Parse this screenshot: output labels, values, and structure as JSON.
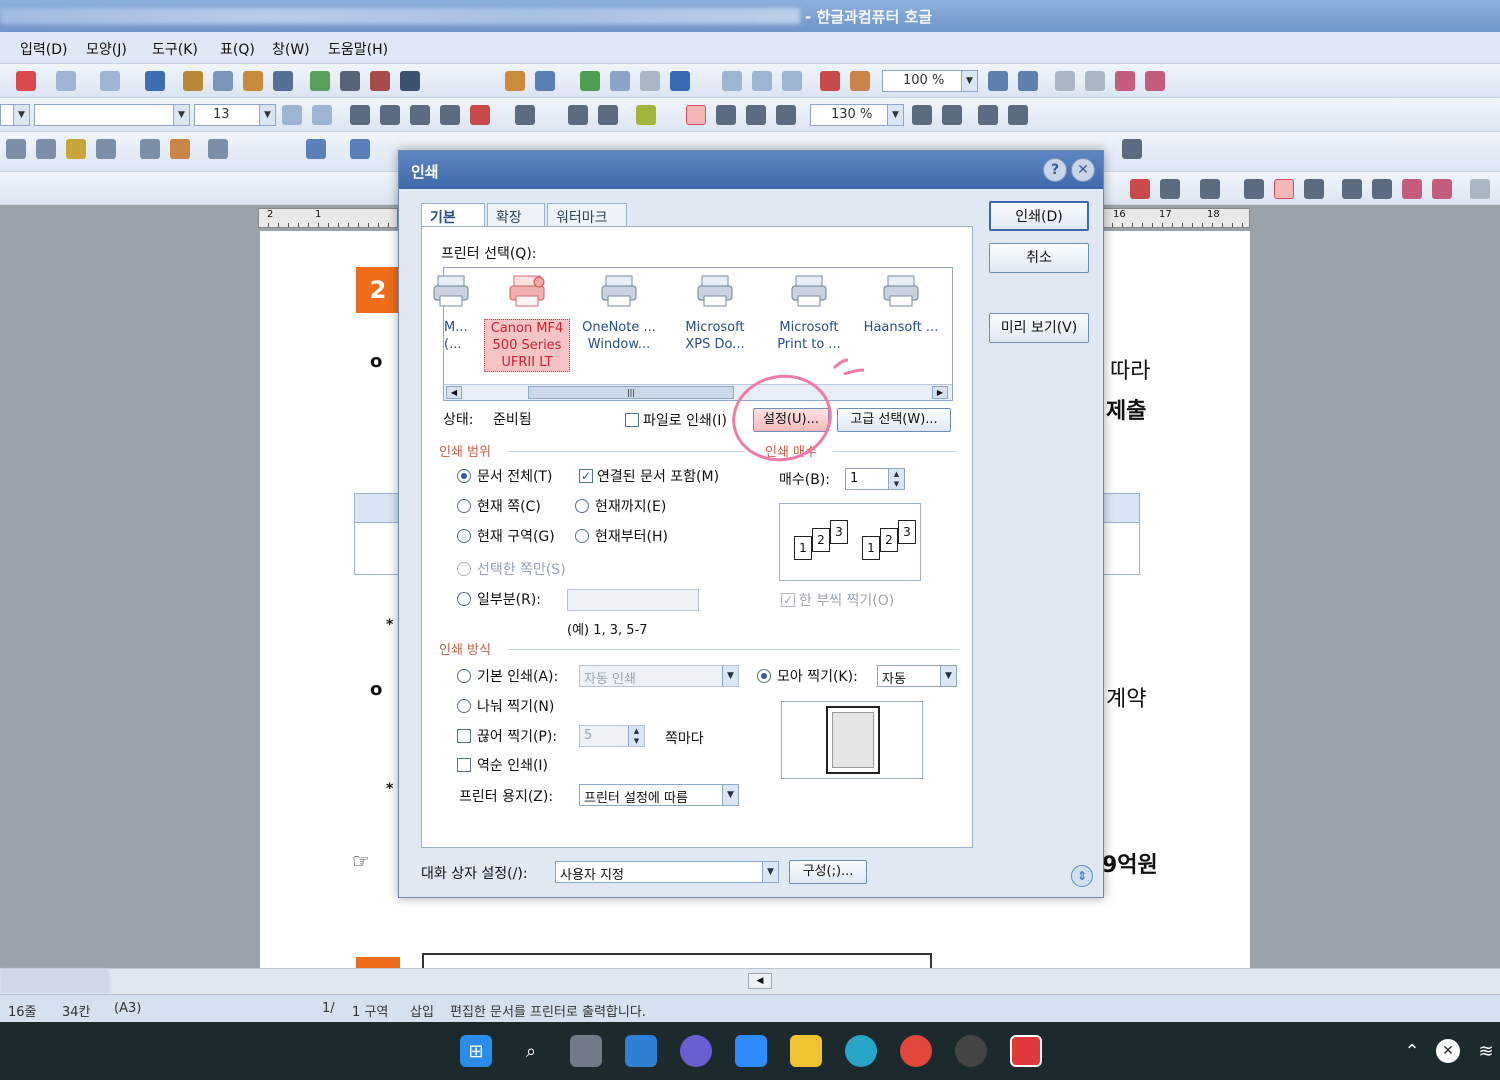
{
  "app": {
    "title": "- 한글과컴퓨터 호글"
  },
  "menu": [
    "입력(D)",
    "모양(J)",
    "도구(K)",
    "표(Q)",
    "창(W)",
    "도움말(H)"
  ],
  "toolbar": {
    "zoom": "100 %",
    "font_size": "13",
    "line_spacing": "130 %"
  },
  "ruler": {
    "left_ticks": [
      "2",
      "1"
    ],
    "right_ticks": [
      "16",
      "17",
      "18"
    ]
  },
  "document": {
    "badge_number": "2",
    "text_right_1": "따라",
    "text_right_2": "제출",
    "text_right_3": "계약",
    "text_right_4": "9억원",
    "bullet": "o",
    "star": "*"
  },
  "dialog": {
    "title": "인쇄",
    "tabs": [
      "기본",
      "확장",
      "워터마크"
    ],
    "printer_select_label": "프린터 선택(Q):",
    "printers": [
      {
        "name": "M...\n(...",
        "selected": false
      },
      {
        "name": "Canon MF4\n500 Series\nUFRII LT",
        "selected": true
      },
      {
        "name": "OneNote ...\nWindow...",
        "selected": false
      },
      {
        "name": "Microsoft\nXPS Do...",
        "selected": false
      },
      {
        "name": "Microsoft\nPrint to ...",
        "selected": false
      },
      {
        "name": "Haansoft ...",
        "selected": false
      }
    ],
    "status_label": "상태:",
    "status_value": "준비됨",
    "print_to_file": "파일로 인쇄(I)",
    "settings_button": "설정(U)...",
    "advanced_button": "고급 선택(W)...",
    "buttons": {
      "print": "인쇄(D)",
      "cancel": "취소",
      "preview": "미리 보기(V)"
    },
    "range_section": "인쇄 범위",
    "range_options": {
      "all": "문서 전체(T)",
      "linked": "연결된 문서 포함(M)",
      "current_page": "현재 쪽(C)",
      "until_current": "현재까지(E)",
      "current_section": "현재 구역(G)",
      "from_current": "현재부터(H)",
      "selected_pages": "선택한 쪽만(S)",
      "partial": "일부분(R):",
      "partial_value": "",
      "example": "(예) 1, 3, 5-7"
    },
    "copies_section": "인쇄 매수",
    "copies_label": "매수(B):",
    "copies_value": "1",
    "collate_label": "한 부씩 찍기(O)",
    "method_section": "인쇄 방식",
    "method": {
      "basic": "기본 인쇄(A):",
      "basic_value": "자동 인쇄",
      "together": "모아 찍기(K):",
      "together_value": "자동",
      "divide": "나눠 찍기(N)",
      "interrupt": "끊어 찍기(P):",
      "interrupt_value": "5",
      "per_page": "쪽마다",
      "reverse": "역순 인쇄(I)",
      "paper_label": "프린터 용지(Z):",
      "paper_value": "프린터 설정에 따름"
    },
    "dialog_settings_label": "대화 상자 설정(/):",
    "dialog_settings_value": "사용자 지정",
    "config_button": "구성(;)..."
  },
  "statusbar": {
    "line": "16줄",
    "column": "34칸",
    "paper": "(A3)",
    "page": "1/",
    "section": "1 구역",
    "mode": "삽입",
    "message": "편집한 문서를 프린터로 출력합니다."
  },
  "colors": {
    "accent": "#3e68a8",
    "highlight": "#f07aa8",
    "section": "#c9614e"
  }
}
